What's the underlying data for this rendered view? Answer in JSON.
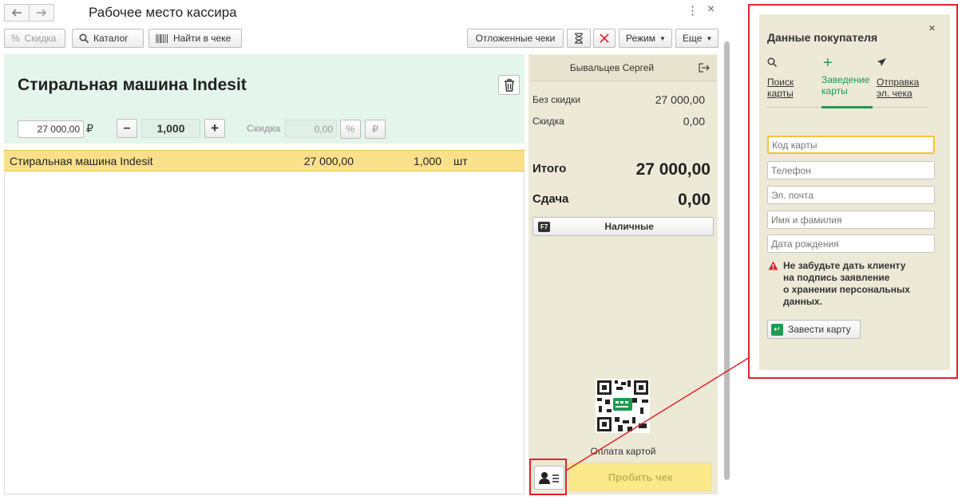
{
  "window": {
    "title": "Рабочее место кассира"
  },
  "toolbar": {
    "discount_label": "Скидка",
    "catalog_label": "Каталог",
    "find_label": "Найти в чеке",
    "postponed_label": "Отложенные чеки",
    "mode_label": "Режим",
    "more_label": "Еще"
  },
  "product": {
    "title": "Стиральная машина Indesit",
    "price": "27 000,00",
    "currency": "₽",
    "quantity": "1,000",
    "discount_label": "Скидка",
    "discount_value": "0,00",
    "percent_symbol": "%",
    "ruble_symbol": "₽"
  },
  "receipt_lines": [
    {
      "name": "Стиральная машина Indesit",
      "price": "27 000,00",
      "qty": "1,000",
      "unit": "шт"
    }
  ],
  "cashier": {
    "name": "Бывальцев Сергей"
  },
  "totals": {
    "no_discount_label": "Без скидки",
    "no_discount_value": "27 000,00",
    "discount_label": "Скидка",
    "discount_value": "0,00",
    "total_label": "Итого",
    "total_value": "27 000,00",
    "change_label": "Сдача",
    "change_value": "0,00"
  },
  "payment": {
    "cash_key": "F7",
    "cash_label": "Наличные",
    "card_caption": "Оплата картой",
    "checkout_label": "Пробить чек"
  },
  "customer_panel": {
    "title": "Данные покупателя",
    "tabs": [
      {
        "label_line1": "Поиск",
        "label_line2": "карты"
      },
      {
        "label_line1": "Заведение",
        "label_line2": "карты"
      },
      {
        "label_line1": "Отправка",
        "label_line2": "эл. чека"
      }
    ],
    "placeholders": {
      "card_code": "Код карты",
      "phone": "Телефон",
      "email": "Эл. почта",
      "name": "Имя и фамилия",
      "birthdate": "Дата рождения"
    },
    "warning_lines": [
      "Не забудьте дать клиенту",
      "на подпись заявление",
      "о хранении персональных",
      "данных."
    ],
    "create_card_label": "Завести карту"
  },
  "colors": {
    "header_green": "#e4f5ec",
    "panel_beige": "#ece9d7",
    "selected_row": "#fbe08c",
    "annotation_red": "#e0242a",
    "accent_green": "#1e9b52",
    "checkout_yellow": "#fbe98a"
  }
}
